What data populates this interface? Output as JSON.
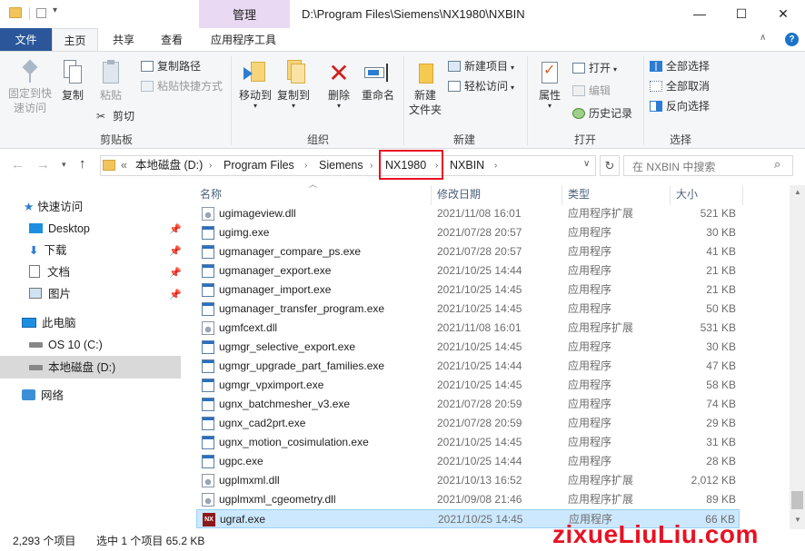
{
  "window": {
    "manage_tab": "管理",
    "title": "D:\\Program Files\\Siemens\\NX1980\\NXBIN",
    "minimize": "—",
    "maximize": "☐",
    "close": "✕"
  },
  "ribbon_tabs": [
    "文件",
    "主页",
    "共享",
    "查看",
    "应用程序工具"
  ],
  "ribbon": {
    "clipboard": {
      "pin_label1": "固定到快",
      "pin_label2": "速访问",
      "copy": "复制",
      "paste": "粘贴",
      "copy_path": "复制路径",
      "paste_shortcut": "粘贴快捷方式",
      "cut": "剪切",
      "group": "剪贴板"
    },
    "organize": {
      "move_to": "移动到",
      "copy_to": "复制到",
      "delete": "删除",
      "rename": "重命名",
      "group": "组织"
    },
    "new": {
      "new_folder1": "新建",
      "new_folder2": "文件夹",
      "new_item": "新建项目",
      "easy_access": "轻松访问",
      "group": "新建"
    },
    "open": {
      "properties": "属性",
      "open": "打开",
      "edit": "编辑",
      "history": "历史记录",
      "group": "打开"
    },
    "select": {
      "select_all": "全部选择",
      "select_none": "全部取消",
      "invert": "反向选择",
      "group": "选择"
    }
  },
  "address": {
    "overflow": "«",
    "crumbs": [
      "本地磁盘 (D:)",
      "Program Files",
      "Siemens",
      "NX1980",
      "NXBIN"
    ],
    "search_placeholder": "在 NXBIN 中搜索"
  },
  "nav": {
    "quick_access": "快速访问",
    "desktop": "Desktop",
    "downloads": "下载",
    "documents": "文档",
    "pictures": "图片",
    "this_pc": "此电脑",
    "os_c": "OS 10 (C:)",
    "local_d": "本地磁盘 (D:)",
    "network": "网络"
  },
  "columns": {
    "name": "名称",
    "date": "修改日期",
    "type": "类型",
    "size": "大小"
  },
  "files": [
    {
      "name": "ugimageview.dll",
      "date": "2021/11/08 16:01",
      "type": "应用程序扩展",
      "size": "521 KB",
      "icon": "dll"
    },
    {
      "name": "ugimg.exe",
      "date": "2021/07/28 20:57",
      "type": "应用程序",
      "size": "30 KB",
      "icon": "exe"
    },
    {
      "name": "ugmanager_compare_ps.exe",
      "date": "2021/07/28 20:57",
      "type": "应用程序",
      "size": "41 KB",
      "icon": "exe"
    },
    {
      "name": "ugmanager_export.exe",
      "date": "2021/10/25 14:44",
      "type": "应用程序",
      "size": "21 KB",
      "icon": "exe"
    },
    {
      "name": "ugmanager_import.exe",
      "date": "2021/10/25 14:45",
      "type": "应用程序",
      "size": "21 KB",
      "icon": "exe"
    },
    {
      "name": "ugmanager_transfer_program.exe",
      "date": "2021/10/25 14:45",
      "type": "应用程序",
      "size": "50 KB",
      "icon": "exe"
    },
    {
      "name": "ugmfcext.dll",
      "date": "2021/11/08 16:01",
      "type": "应用程序扩展",
      "size": "531 KB",
      "icon": "dll"
    },
    {
      "name": "ugmgr_selective_export.exe",
      "date": "2021/10/25 14:45",
      "type": "应用程序",
      "size": "30 KB",
      "icon": "exe"
    },
    {
      "name": "ugmgr_upgrade_part_families.exe",
      "date": "2021/10/25 14:44",
      "type": "应用程序",
      "size": "47 KB",
      "icon": "exe"
    },
    {
      "name": "ugmgr_vpximport.exe",
      "date": "2021/10/25 14:45",
      "type": "应用程序",
      "size": "58 KB",
      "icon": "exe"
    },
    {
      "name": "ugnx_batchmesher_v3.exe",
      "date": "2021/07/28 20:59",
      "type": "应用程序",
      "size": "74 KB",
      "icon": "exe"
    },
    {
      "name": "ugnx_cad2prt.exe",
      "date": "2021/07/28 20:59",
      "type": "应用程序",
      "size": "29 KB",
      "icon": "exe"
    },
    {
      "name": "ugnx_motion_cosimulation.exe",
      "date": "2021/10/25 14:45",
      "type": "应用程序",
      "size": "31 KB",
      "icon": "exe"
    },
    {
      "name": "ugpc.exe",
      "date": "2021/10/25 14:44",
      "type": "应用程序",
      "size": "28 KB",
      "icon": "exe"
    },
    {
      "name": "ugplmxml.dll",
      "date": "2021/10/13 16:52",
      "type": "应用程序扩展",
      "size": "2,012 KB",
      "icon": "dll"
    },
    {
      "name": "ugplmxml_cgeometry.dll",
      "date": "2021/09/08 21:46",
      "type": "应用程序扩展",
      "size": "89 KB",
      "icon": "dll"
    },
    {
      "name": "ugraf.exe",
      "date": "2021/10/25 14:45",
      "type": "应用程序",
      "size": "66 KB",
      "icon": "nx",
      "selected": true
    }
  ],
  "status": {
    "count": "2,293 个项目",
    "selection": "选中 1 个项目  65.2 KB"
  },
  "watermark": "zixueLiuLiu.com",
  "colors": {
    "accent": "#2b579a",
    "highlight_box": "#e81123",
    "selection": "#cce8ff",
    "manage_tab": "#e9d9f3"
  }
}
